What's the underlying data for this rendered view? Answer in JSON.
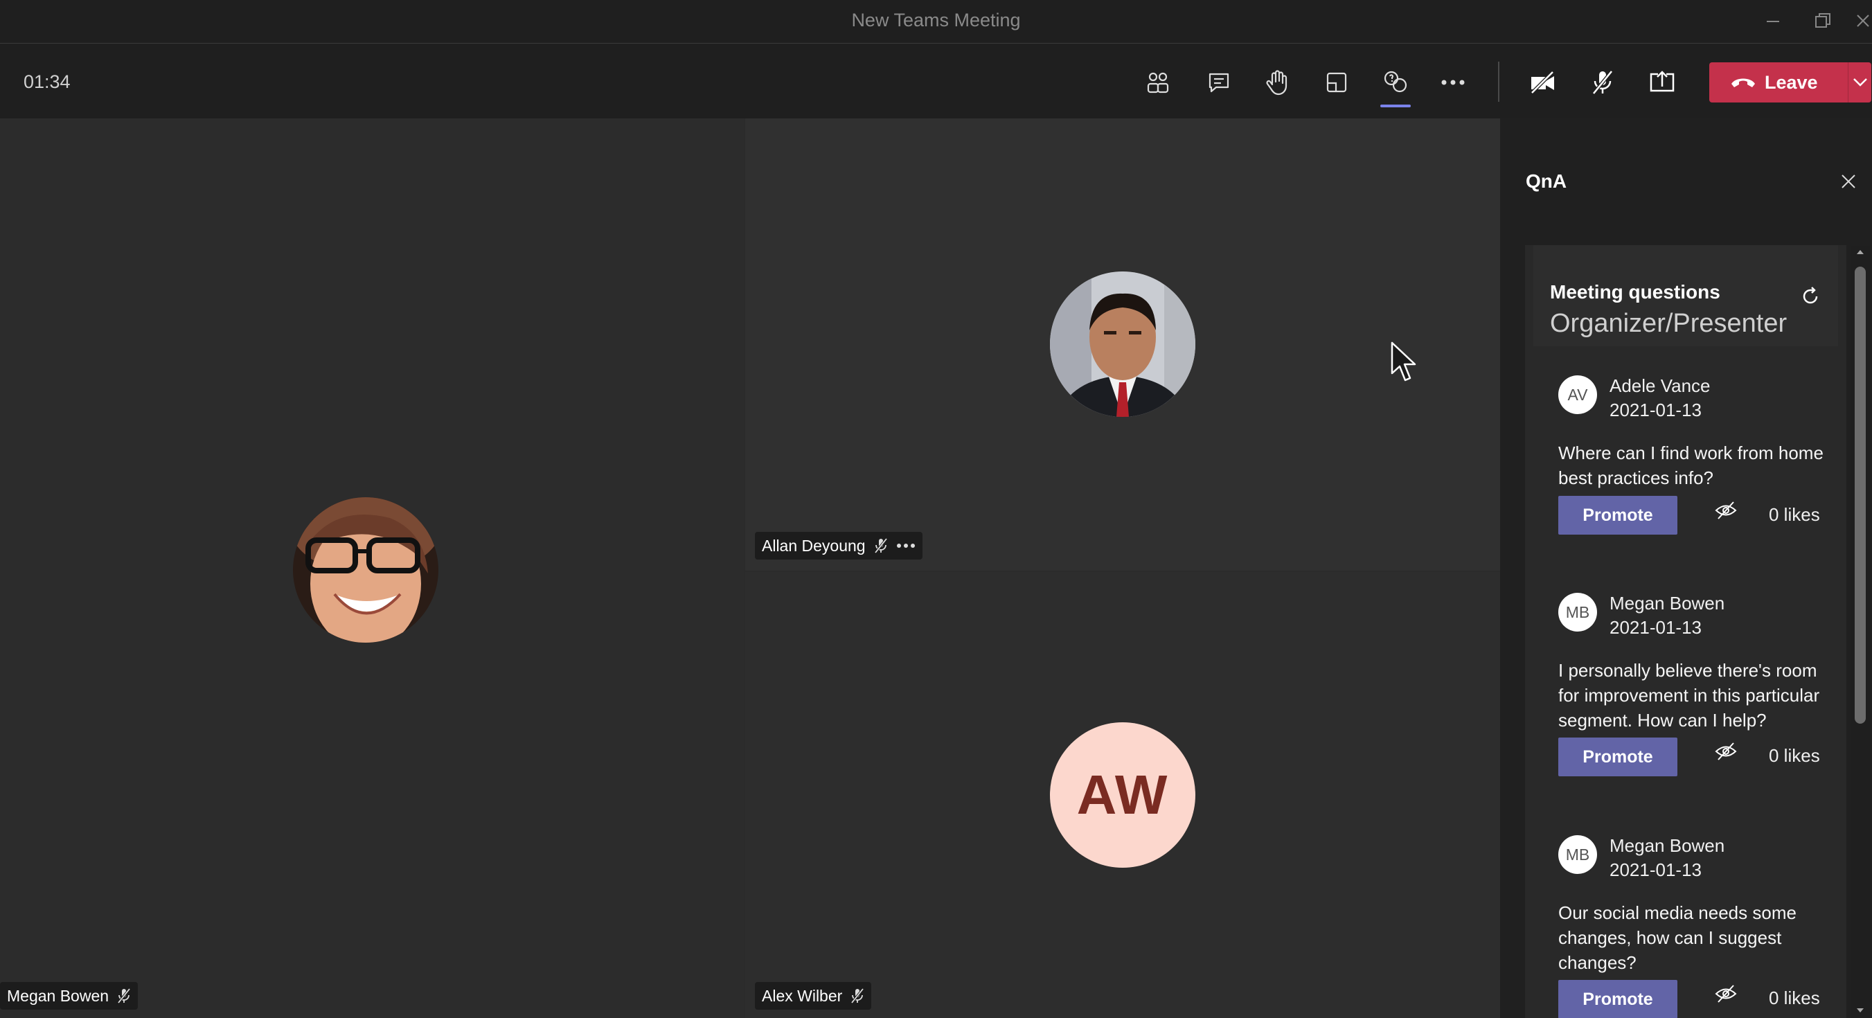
{
  "window": {
    "title": "New Teams Meeting"
  },
  "toolbar": {
    "timer": "01:34",
    "leave_label": "Leave",
    "accent": "#7b83eb",
    "leave_color": "#c4314b"
  },
  "participants": [
    {
      "name": "Megan Bowen",
      "muted": true
    },
    {
      "name": "Allan Deyoung",
      "muted": true
    },
    {
      "name": "Alex Wilber",
      "initials": "AW",
      "muted": true
    }
  ],
  "panel": {
    "title": "QnA",
    "section_title": "Meeting questions",
    "section_subtitle": "Organizer/Presenter",
    "questions": [
      {
        "initials": "AV",
        "author": "Adele Vance",
        "date": "2021-01-13",
        "text": "Where can I find work from home best practices info?",
        "promote_label": "Promote",
        "likes": "0 likes"
      },
      {
        "initials": "MB",
        "author": "Megan Bowen",
        "date": "2021-01-13",
        "text": "I personally believe there's room for improvement in this particular segment. How can I help?",
        "promote_label": "Promote",
        "likes": "0 likes"
      },
      {
        "initials": "MB",
        "author": "Megan Bowen",
        "date": "2021-01-13",
        "text": "Our social media needs some changes, how can I suggest changes?",
        "promote_label": "Promote",
        "likes": "0 likes"
      }
    ]
  },
  "icons": {
    "toolbar": [
      "people-icon",
      "chat-icon",
      "raise-hand-icon",
      "rooms-icon",
      "qna-app-icon",
      "more-options-icon",
      "camera-off-icon",
      "mic-off-icon",
      "share-screen-icon",
      "phone-hangup-icon",
      "chevron-down-icon"
    ]
  }
}
